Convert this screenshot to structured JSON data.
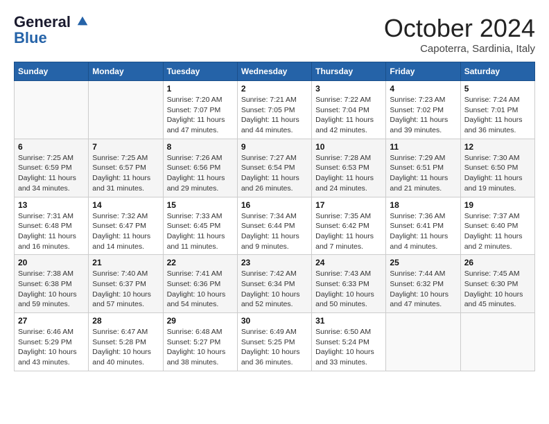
{
  "header": {
    "logo_line1": "General",
    "logo_line2": "Blue",
    "month": "October 2024",
    "location": "Capoterra, Sardinia, Italy"
  },
  "weekdays": [
    "Sunday",
    "Monday",
    "Tuesday",
    "Wednesday",
    "Thursday",
    "Friday",
    "Saturday"
  ],
  "weeks": [
    [
      {
        "num": "",
        "info": ""
      },
      {
        "num": "",
        "info": ""
      },
      {
        "num": "1",
        "info": "Sunrise: 7:20 AM\nSunset: 7:07 PM\nDaylight: 11 hours and 47 minutes."
      },
      {
        "num": "2",
        "info": "Sunrise: 7:21 AM\nSunset: 7:05 PM\nDaylight: 11 hours and 44 minutes."
      },
      {
        "num": "3",
        "info": "Sunrise: 7:22 AM\nSunset: 7:04 PM\nDaylight: 11 hours and 42 minutes."
      },
      {
        "num": "4",
        "info": "Sunrise: 7:23 AM\nSunset: 7:02 PM\nDaylight: 11 hours and 39 minutes."
      },
      {
        "num": "5",
        "info": "Sunrise: 7:24 AM\nSunset: 7:01 PM\nDaylight: 11 hours and 36 minutes."
      }
    ],
    [
      {
        "num": "6",
        "info": "Sunrise: 7:25 AM\nSunset: 6:59 PM\nDaylight: 11 hours and 34 minutes."
      },
      {
        "num": "7",
        "info": "Sunrise: 7:25 AM\nSunset: 6:57 PM\nDaylight: 11 hours and 31 minutes."
      },
      {
        "num": "8",
        "info": "Sunrise: 7:26 AM\nSunset: 6:56 PM\nDaylight: 11 hours and 29 minutes."
      },
      {
        "num": "9",
        "info": "Sunrise: 7:27 AM\nSunset: 6:54 PM\nDaylight: 11 hours and 26 minutes."
      },
      {
        "num": "10",
        "info": "Sunrise: 7:28 AM\nSunset: 6:53 PM\nDaylight: 11 hours and 24 minutes."
      },
      {
        "num": "11",
        "info": "Sunrise: 7:29 AM\nSunset: 6:51 PM\nDaylight: 11 hours and 21 minutes."
      },
      {
        "num": "12",
        "info": "Sunrise: 7:30 AM\nSunset: 6:50 PM\nDaylight: 11 hours and 19 minutes."
      }
    ],
    [
      {
        "num": "13",
        "info": "Sunrise: 7:31 AM\nSunset: 6:48 PM\nDaylight: 11 hours and 16 minutes."
      },
      {
        "num": "14",
        "info": "Sunrise: 7:32 AM\nSunset: 6:47 PM\nDaylight: 11 hours and 14 minutes."
      },
      {
        "num": "15",
        "info": "Sunrise: 7:33 AM\nSunset: 6:45 PM\nDaylight: 11 hours and 11 minutes."
      },
      {
        "num": "16",
        "info": "Sunrise: 7:34 AM\nSunset: 6:44 PM\nDaylight: 11 hours and 9 minutes."
      },
      {
        "num": "17",
        "info": "Sunrise: 7:35 AM\nSunset: 6:42 PM\nDaylight: 11 hours and 7 minutes."
      },
      {
        "num": "18",
        "info": "Sunrise: 7:36 AM\nSunset: 6:41 PM\nDaylight: 11 hours and 4 minutes."
      },
      {
        "num": "19",
        "info": "Sunrise: 7:37 AM\nSunset: 6:40 PM\nDaylight: 11 hours and 2 minutes."
      }
    ],
    [
      {
        "num": "20",
        "info": "Sunrise: 7:38 AM\nSunset: 6:38 PM\nDaylight: 10 hours and 59 minutes."
      },
      {
        "num": "21",
        "info": "Sunrise: 7:40 AM\nSunset: 6:37 PM\nDaylight: 10 hours and 57 minutes."
      },
      {
        "num": "22",
        "info": "Sunrise: 7:41 AM\nSunset: 6:36 PM\nDaylight: 10 hours and 54 minutes."
      },
      {
        "num": "23",
        "info": "Sunrise: 7:42 AM\nSunset: 6:34 PM\nDaylight: 10 hours and 52 minutes."
      },
      {
        "num": "24",
        "info": "Sunrise: 7:43 AM\nSunset: 6:33 PM\nDaylight: 10 hours and 50 minutes."
      },
      {
        "num": "25",
        "info": "Sunrise: 7:44 AM\nSunset: 6:32 PM\nDaylight: 10 hours and 47 minutes."
      },
      {
        "num": "26",
        "info": "Sunrise: 7:45 AM\nSunset: 6:30 PM\nDaylight: 10 hours and 45 minutes."
      }
    ],
    [
      {
        "num": "27",
        "info": "Sunrise: 6:46 AM\nSunset: 5:29 PM\nDaylight: 10 hours and 43 minutes."
      },
      {
        "num": "28",
        "info": "Sunrise: 6:47 AM\nSunset: 5:28 PM\nDaylight: 10 hours and 40 minutes."
      },
      {
        "num": "29",
        "info": "Sunrise: 6:48 AM\nSunset: 5:27 PM\nDaylight: 10 hours and 38 minutes."
      },
      {
        "num": "30",
        "info": "Sunrise: 6:49 AM\nSunset: 5:25 PM\nDaylight: 10 hours and 36 minutes."
      },
      {
        "num": "31",
        "info": "Sunrise: 6:50 AM\nSunset: 5:24 PM\nDaylight: 10 hours and 33 minutes."
      },
      {
        "num": "",
        "info": ""
      },
      {
        "num": "",
        "info": ""
      }
    ]
  ]
}
